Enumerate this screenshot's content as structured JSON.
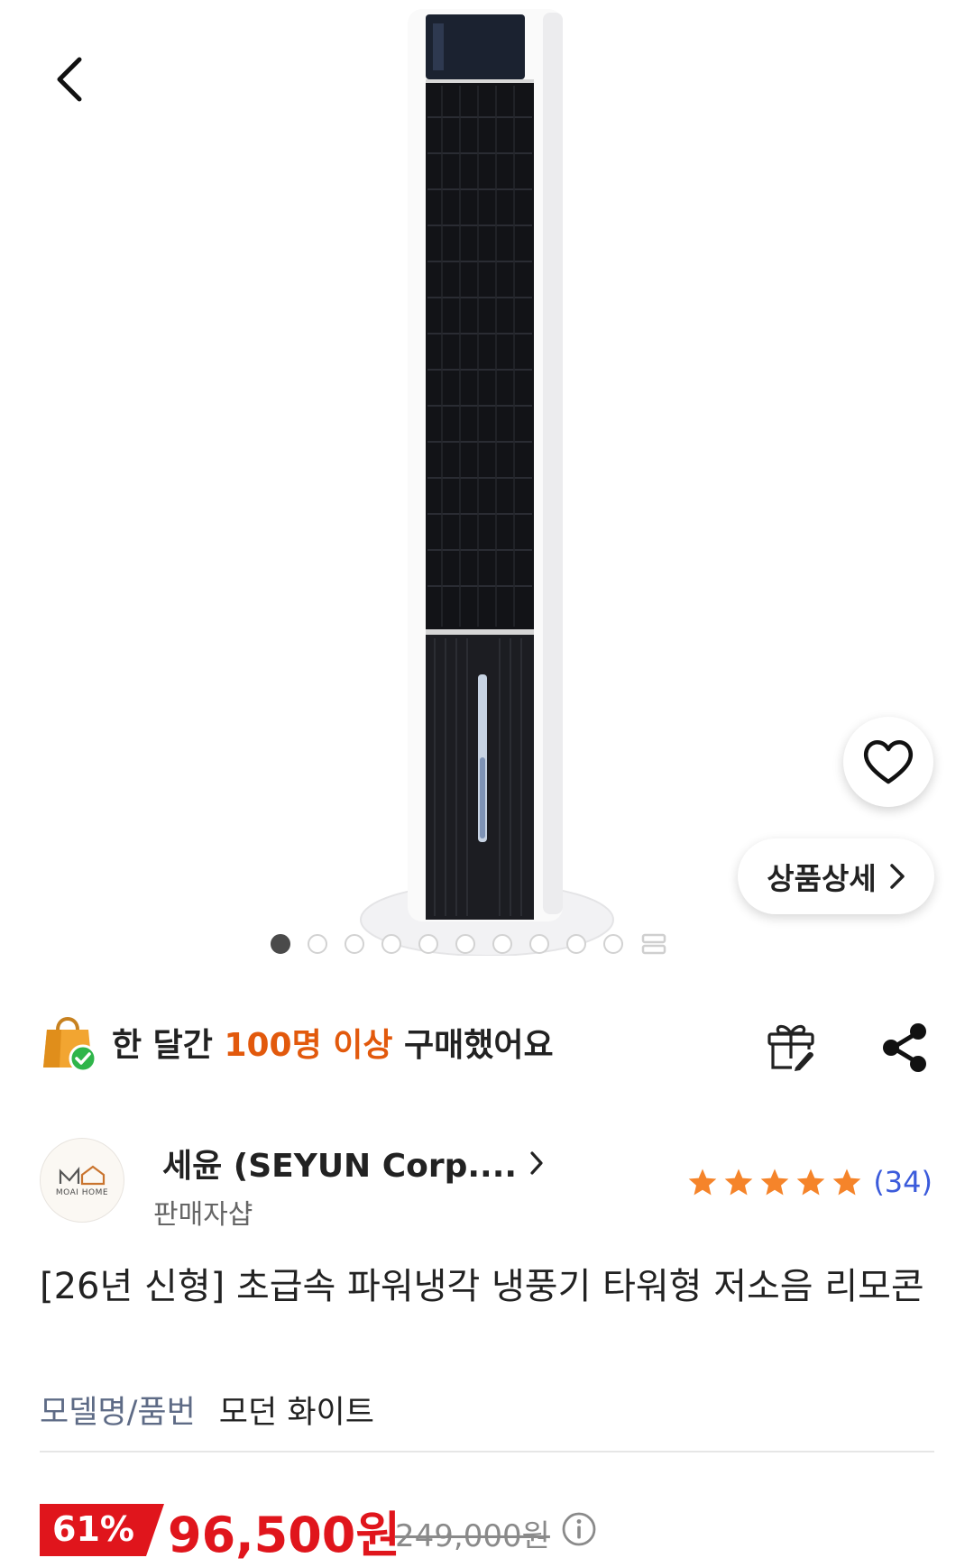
{
  "gallery": {
    "total_dots": 10,
    "active_index": 0,
    "detail_button_label": "상품상세"
  },
  "purchase_badge": {
    "prefix": "한 달간 ",
    "highlight": "100명 이상",
    "suffix": " 구매했어요"
  },
  "seller": {
    "name": "세윤 (SEYUN Corp....",
    "type": "판매자샵",
    "logo_text": "MOAI HOME",
    "rating_stars": 5,
    "review_count": "(34)"
  },
  "product": {
    "title": "[26년 신형] 초급속 파워냉각 냉풍기 타워형 저소음 리모콘",
    "model_label": "모델명/품번",
    "model_value": "모던 화이트"
  },
  "price": {
    "discount": "61%",
    "sale_price": "96,500원",
    "original_price": "249,000원"
  },
  "colors": {
    "accent_orange": "#e2590c",
    "price_red": "#e0151c",
    "star_orange": "#f5842a",
    "review_blue": "#3b5bdb"
  },
  "icons": [
    "back-arrow-icon",
    "heart-icon",
    "chevron-right-icon",
    "shopping-bag-check-icon",
    "gift-icon",
    "share-icon",
    "star-icon",
    "info-icon"
  ]
}
